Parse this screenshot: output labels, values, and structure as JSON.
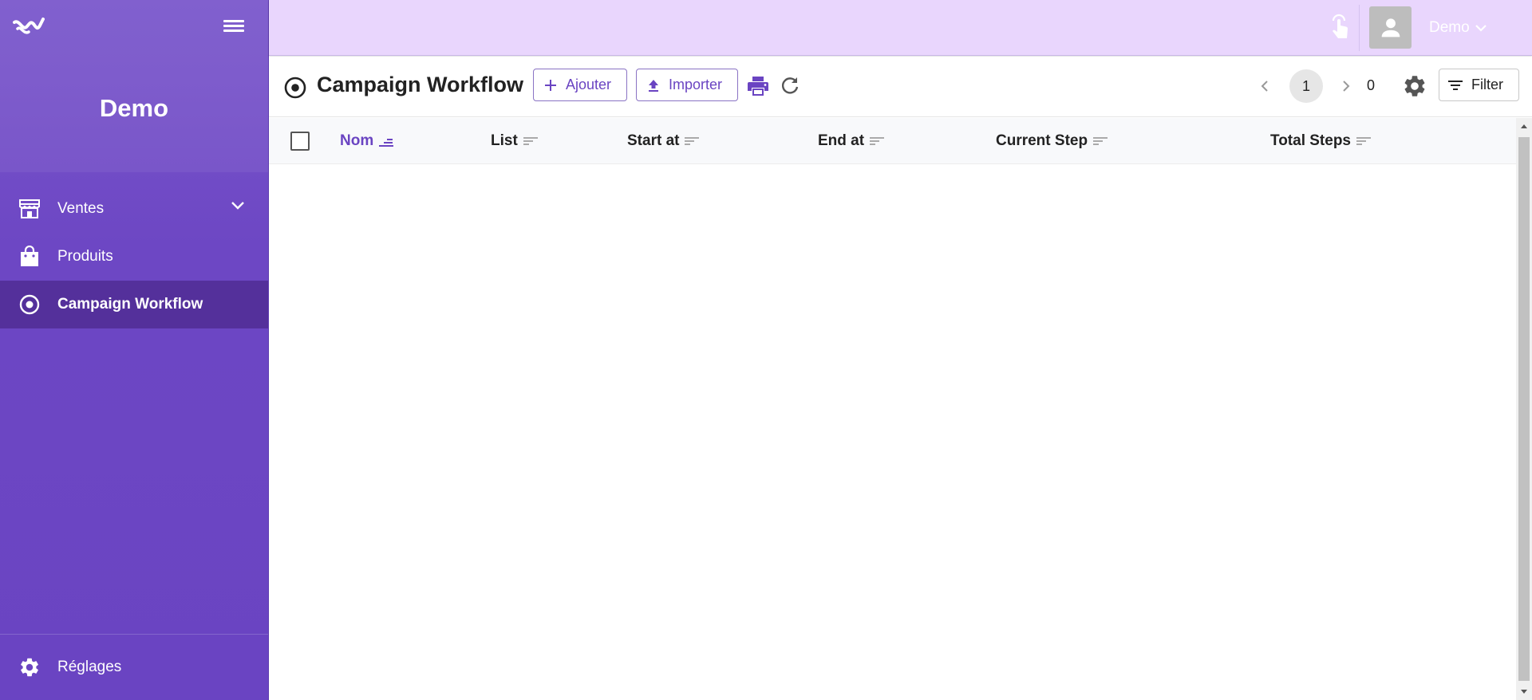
{
  "sidebar": {
    "title": "Demo",
    "items": [
      {
        "label": "Ventes",
        "icon": "store-icon",
        "expandable": true
      },
      {
        "label": "Produits",
        "icon": "shopping-bag-icon"
      },
      {
        "label": "Campaign Workflow",
        "icon": "radio-target-icon",
        "active": true
      }
    ],
    "settings_label": "Réglages"
  },
  "topbar": {
    "user_label": "Demo"
  },
  "toolbar": {
    "page_title": "Campaign Workflow",
    "add_label": "Ajouter",
    "import_label": "Importer",
    "filter_label": "Filter"
  },
  "pagination": {
    "current_page": "1",
    "total": "0"
  },
  "table": {
    "columns": [
      "Nom",
      "List",
      "Start at",
      "End at",
      "Current Step",
      "Total Steps"
    ],
    "sorted_column": "Nom",
    "rows": []
  },
  "colors": {
    "sidebar_bg": "#7a57cb",
    "sidebar_active": "#54309b",
    "topbar_bg": "#e9d6fd",
    "accent": "#6a44c2"
  }
}
